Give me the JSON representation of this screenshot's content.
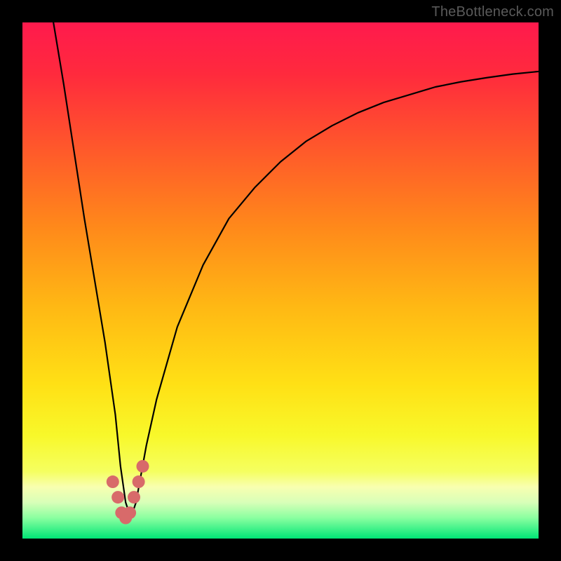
{
  "watermark": "TheBottleneck.com",
  "chart_data": {
    "type": "line",
    "title": "",
    "xlabel": "",
    "ylabel": "",
    "xlim": [
      0,
      100
    ],
    "ylim": [
      0,
      100
    ],
    "grid": false,
    "series": [
      {
        "name": "bottleneck-curve",
        "x": [
          6,
          8,
          10,
          12,
          14,
          16,
          18,
          19,
          20,
          21,
          22,
          24,
          26,
          30,
          35,
          40,
          45,
          50,
          55,
          60,
          65,
          70,
          75,
          80,
          85,
          90,
          95,
          100
        ],
        "y": [
          100,
          88,
          75,
          62,
          50,
          38,
          24,
          14,
          7,
          4,
          7,
          18,
          27,
          41,
          53,
          62,
          68,
          73,
          77,
          80,
          82.5,
          84.5,
          86,
          87.5,
          88.5,
          89.3,
          90,
          90.5
        ]
      }
    ],
    "markers": {
      "name": "highlight-points",
      "x": [
        17.5,
        18.5,
        19.2,
        20,
        20.8,
        21.6,
        22.5,
        23.3
      ],
      "y": [
        11,
        8,
        5,
        4,
        5,
        8,
        11,
        14
      ]
    },
    "gradient_stops": [
      {
        "offset": 0.0,
        "color": "#ff1a4d"
      },
      {
        "offset": 0.1,
        "color": "#ff2a3d"
      },
      {
        "offset": 0.25,
        "color": "#ff5a2a"
      },
      {
        "offset": 0.4,
        "color": "#ff8a1a"
      },
      {
        "offset": 0.55,
        "color": "#ffb814"
      },
      {
        "offset": 0.7,
        "color": "#ffe015"
      },
      {
        "offset": 0.8,
        "color": "#f8f82a"
      },
      {
        "offset": 0.87,
        "color": "#f5ff60"
      },
      {
        "offset": 0.9,
        "color": "#f8ffb0"
      },
      {
        "offset": 0.93,
        "color": "#d8ffb8"
      },
      {
        "offset": 0.96,
        "color": "#8affa0"
      },
      {
        "offset": 1.0,
        "color": "#00e676"
      }
    ]
  }
}
